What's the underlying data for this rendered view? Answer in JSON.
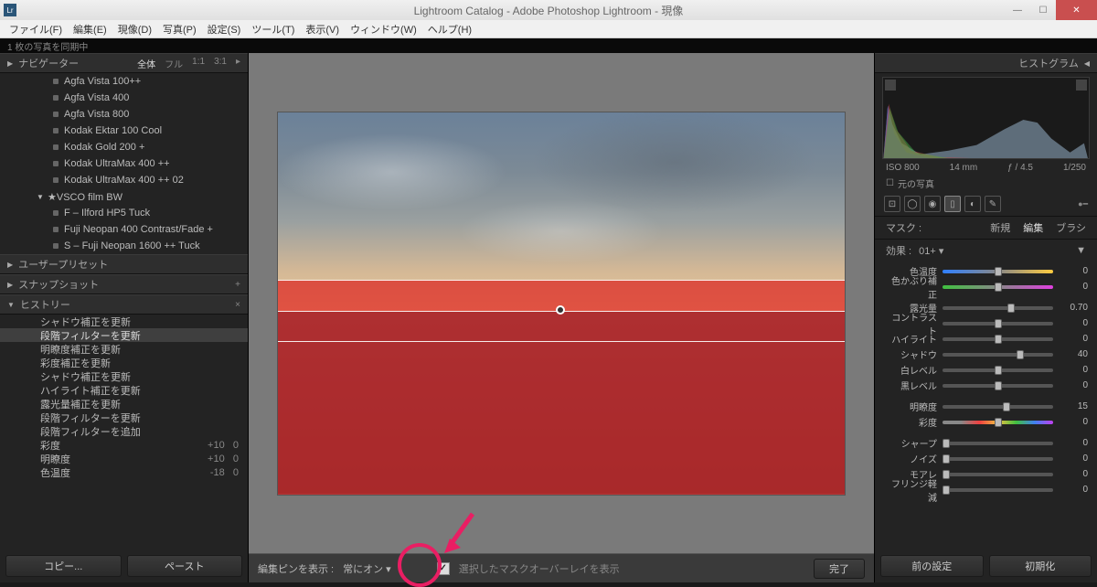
{
  "title": "Lightroom Catalog - Adobe Photoshop Lightroom - 現像",
  "menu": [
    "ファイル(F)",
    "編集(E)",
    "現像(D)",
    "写真(P)",
    "設定(S)",
    "ツール(T)",
    "表示(V)",
    "ウィンドウ(W)",
    "ヘルプ(H)"
  ],
  "status": "1 枚の写真を同期中",
  "nav": {
    "label": "ナビゲーター",
    "modes": [
      "全体",
      "フル",
      "1:1",
      "3:1"
    ],
    "mode_icon": "▸"
  },
  "presets": [
    {
      "type": "item",
      "label": "Agfa Vista 100++"
    },
    {
      "type": "item",
      "label": "Agfa Vista 400"
    },
    {
      "type": "item",
      "label": "Agfa Vista 800"
    },
    {
      "type": "item",
      "label": "Kodak Ektar 100 Cool"
    },
    {
      "type": "item",
      "label": "Kodak Gold 200 +"
    },
    {
      "type": "item",
      "label": "Kodak UltraMax 400 ++"
    },
    {
      "type": "item",
      "label": "Kodak UltraMax 400 ++ 02"
    },
    {
      "type": "folder",
      "label": "★VSCO film BW"
    },
    {
      "type": "item",
      "label": "F – Ilford HP5 Tuck"
    },
    {
      "type": "item",
      "label": "Fuji Neopan 400 Contrast/Fade +"
    },
    {
      "type": "item",
      "label": "S – Fuji Neopan 1600 ++ Tuck"
    },
    {
      "type": "head",
      "label": "ユーザープリセット"
    }
  ],
  "snapshot": "スナップショット",
  "history_label": "ヒストリー",
  "history": [
    {
      "label": "シャドウ補正を更新"
    },
    {
      "label": "段階フィルターを更新",
      "sel": true
    },
    {
      "label": "明瞭度補正を更新"
    },
    {
      "label": "彩度補正を更新"
    },
    {
      "label": "シャドウ補正を更新"
    },
    {
      "label": "ハイライト補正を更新"
    },
    {
      "label": "露光量補正を更新"
    },
    {
      "label": "段階フィルターを更新"
    },
    {
      "label": "段階フィルターを追加"
    },
    {
      "label": "彩度",
      "val": "+10",
      "val2": "0"
    },
    {
      "label": "明瞭度",
      "val": "+10",
      "val2": "0"
    },
    {
      "label": "色温度",
      "val": "-18",
      "val2": "0"
    }
  ],
  "copy_btn": "コピー...",
  "paste_btn": "ペースト",
  "toolbar": {
    "pins": "編集ピンを表示 :",
    "mode": "常にオン ▾",
    "chk_label": "選択したマスクオーバーレイを表示",
    "done": "完了"
  },
  "right": {
    "histo": "ヒストグラム",
    "meta": {
      "iso": "ISO 800",
      "mm": "14 mm",
      "f": "ƒ / 4.5",
      "s": "1/250"
    },
    "orig": "元の写真",
    "mask": {
      "label": "マスク :",
      "new": "新規",
      "edit": "編集",
      "brush": "ブラシ"
    },
    "effect": {
      "label": "効果 :",
      "val": "01+ ▾"
    },
    "sliders1": [
      {
        "lbl": "色温度",
        "val": "0",
        "pos": 50,
        "grad": "linear-gradient(90deg,#3080ff,#888,#ffcc40)"
      },
      {
        "lbl": "色かぶり補正",
        "val": "0",
        "pos": 50,
        "grad": "linear-gradient(90deg,#40c040,#888,#e040e0)"
      }
    ],
    "sliders2": [
      {
        "lbl": "露光量",
        "val": "0.70",
        "pos": 62,
        "grad": "#555"
      },
      {
        "lbl": "コントラスト",
        "val": "0",
        "pos": 50,
        "grad": "#555"
      },
      {
        "lbl": "ハイライト",
        "val": "0",
        "pos": 50,
        "grad": "#555"
      },
      {
        "lbl": "シャドウ",
        "val": "40",
        "pos": 70,
        "grad": "#555"
      },
      {
        "lbl": "白レベル",
        "val": "0",
        "pos": 50,
        "grad": "#555"
      },
      {
        "lbl": "黒レベル",
        "val": "0",
        "pos": 50,
        "grad": "#555"
      }
    ],
    "sliders3": [
      {
        "lbl": "明瞭度",
        "val": "15",
        "pos": 58,
        "grad": "#555"
      },
      {
        "lbl": "彩度",
        "val": "0",
        "pos": 50,
        "grad": "linear-gradient(90deg,#888,#888,#f04040,#f0c040,#40c040,#4080f0,#c040f0)"
      }
    ],
    "sliders4": [
      {
        "lbl": "シャープ",
        "val": "0",
        "pos": 3,
        "grad": "#555"
      },
      {
        "lbl": "ノイズ",
        "val": "0",
        "pos": 3,
        "grad": "#555"
      },
      {
        "lbl": "モアレ",
        "val": "0",
        "pos": 3,
        "grad": "#555"
      },
      {
        "lbl": "フリンジ軽減",
        "val": "0",
        "pos": 3,
        "grad": "#555"
      }
    ],
    "prev_btn": "前の設定",
    "reset_btn": "初期化"
  }
}
